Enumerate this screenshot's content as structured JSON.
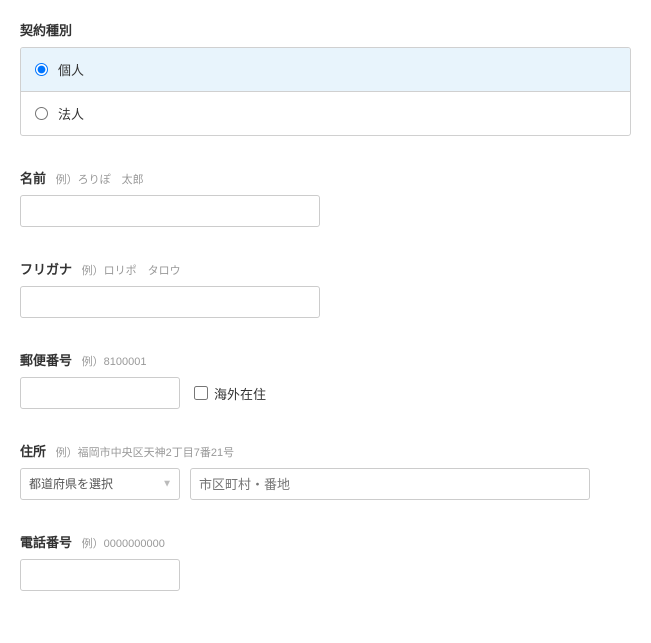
{
  "contract_type": {
    "label": "契約種別",
    "options": [
      {
        "label": "個人",
        "value": "individual",
        "selected": true
      },
      {
        "label": "法人",
        "value": "corporate",
        "selected": false
      }
    ]
  },
  "name": {
    "label": "名前",
    "hint": "例）ろりぽ　太郎",
    "value": ""
  },
  "furigana": {
    "label": "フリガナ",
    "hint": "例）ロリポ　タロウ",
    "value": ""
  },
  "postal": {
    "label": "郵便番号",
    "hint": "例）8100001",
    "value": "",
    "overseas_label": "海外在住"
  },
  "address": {
    "label": "住所",
    "hint": "例）福岡市中央区天神2丁目7番21号",
    "prefecture_placeholder": "都道府県を選択",
    "city_placeholder": "市区町村・番地"
  },
  "phone": {
    "label": "電話番号",
    "hint": "例）0000000000",
    "value": ""
  }
}
